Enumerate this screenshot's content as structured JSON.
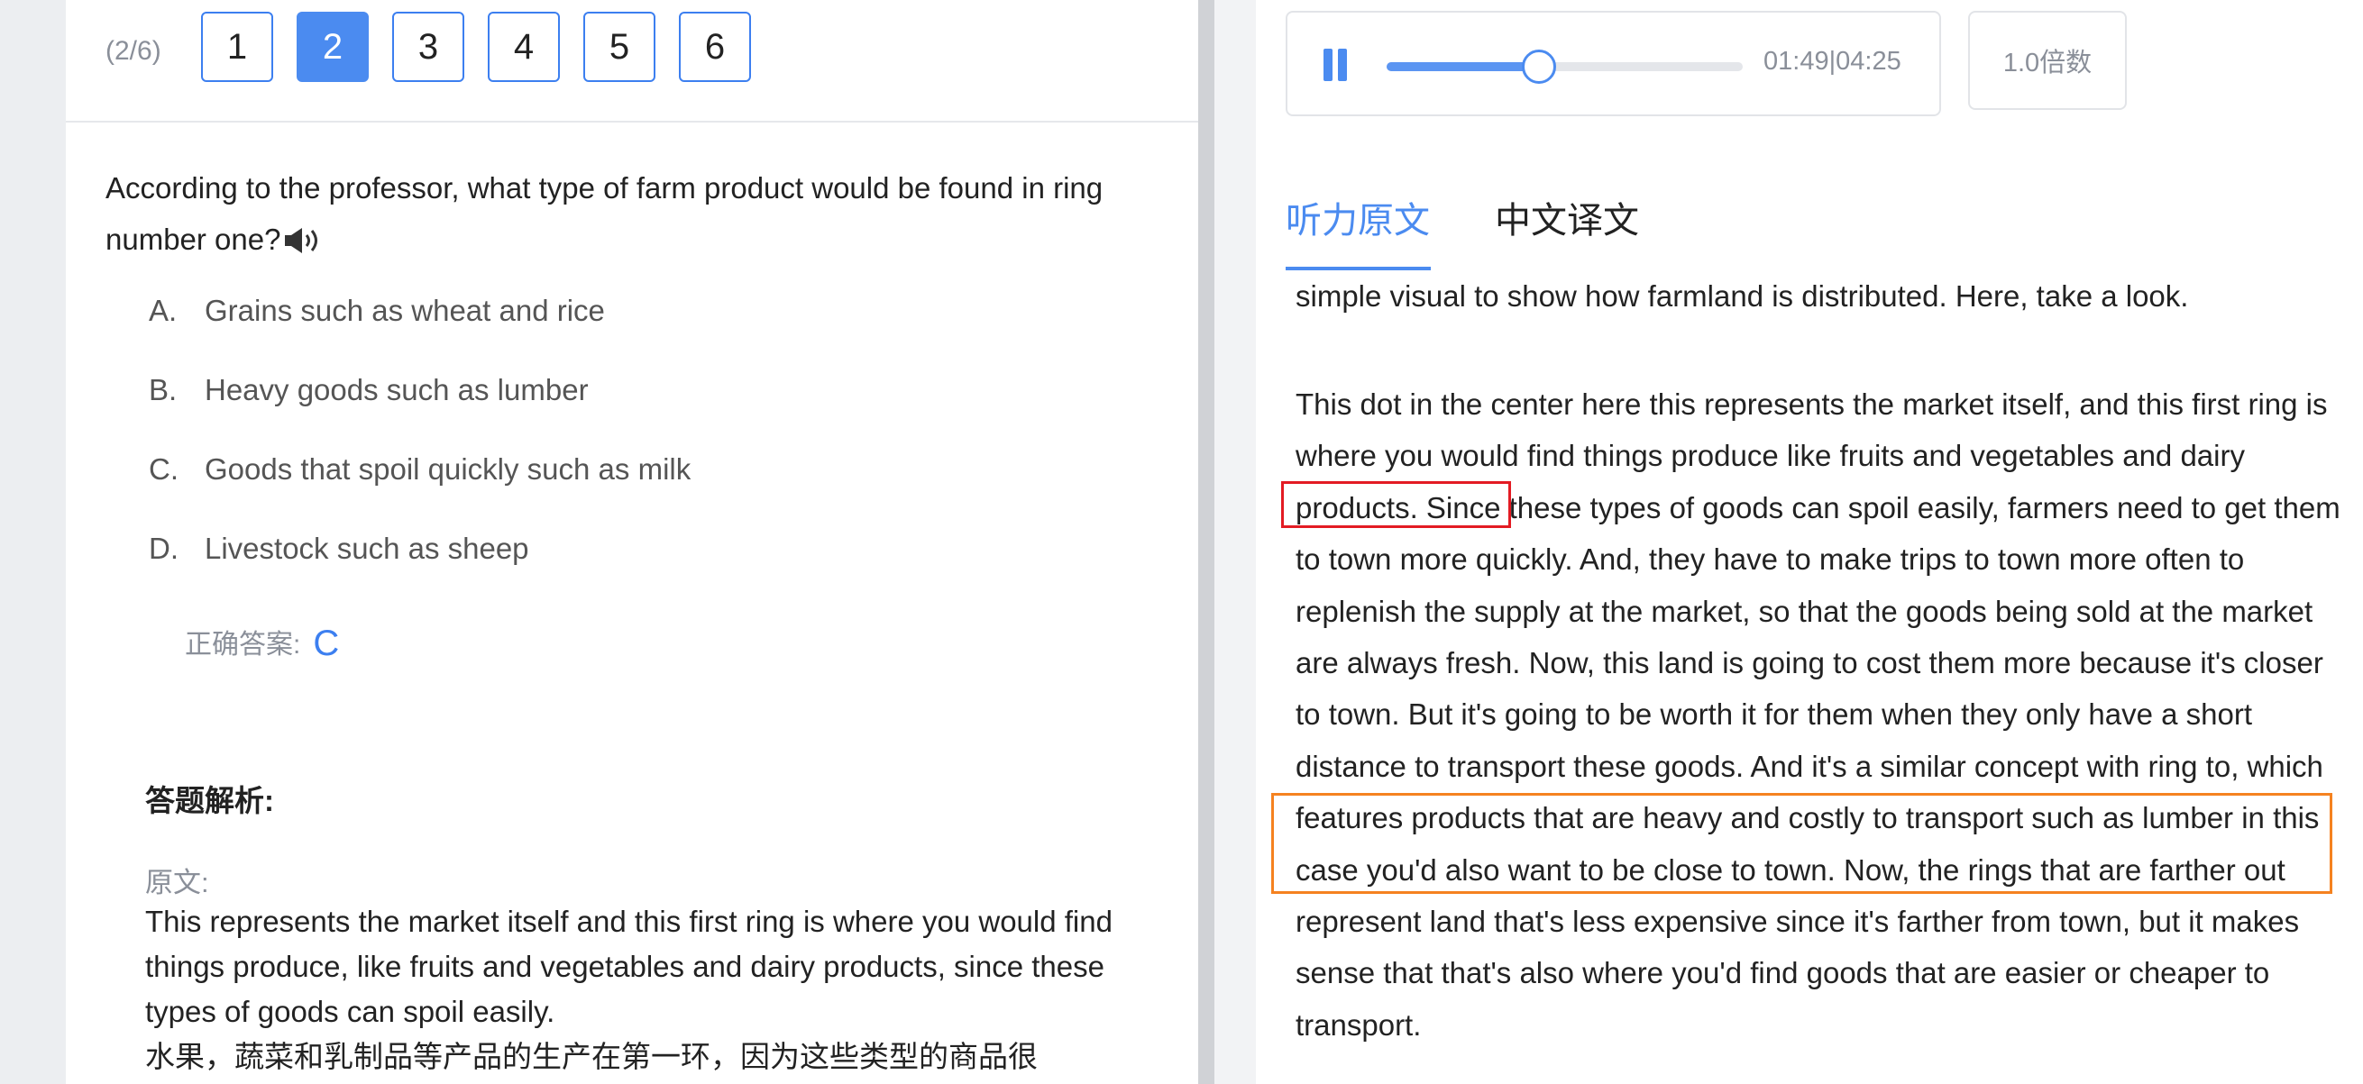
{
  "question_nav": {
    "progress": "(2/6)",
    "buttons": [
      "1",
      "2",
      "3",
      "4",
      "5",
      "6"
    ],
    "active_index": 1
  },
  "question": {
    "text": "According to the professor, what type of farm product would be found in ring number one?",
    "speaker_icon": "speaker-icon"
  },
  "options": [
    {
      "letter": "A.",
      "text": "Grains such as wheat and rice"
    },
    {
      "letter": "B.",
      "text": "Heavy goods such as lumber"
    },
    {
      "letter": "C.",
      "text": "Goods that spoil quickly such as milk"
    },
    {
      "letter": "D.",
      "text": "Livestock such as sheep"
    }
  ],
  "answer": {
    "label": "正确答案:",
    "value": "C"
  },
  "analysis": {
    "title": "答题解析:",
    "original_label": "原文:",
    "original_text": "This represents the market itself and this first ring is where you would find things produce, like fruits and vegetables and dairy products, since these types of goods can spoil easily.",
    "translation_text": "水果，蔬菜和乳制品等产品的生产在第一环，因为这些类型的商品很"
  },
  "player": {
    "current_time": "01:49",
    "total_time": "04:25",
    "progress": 0.4275,
    "speed_label": "1.0倍数",
    "accent_color": "#4b8bf0"
  },
  "tabs": [
    {
      "label": "听力原文",
      "active": true
    },
    {
      "label": "中文译文",
      "active": false
    }
  ],
  "transcript": {
    "para_0": "simple visual to show how farmland is distributed. Here, take a look.",
    "para_1_before": "This dot in the center here this represents the market itself, and this first ring is where you would find things produce like fruits and vegetables and ",
    "para_1_red": "dairy products.",
    "para_1_middle": " Since these types of goods can spoil easily, farmers need to get them to town more quickly. And, they have to make trips to town more often to replenish the supply at the market, so that the goods being sold at the market are always fresh. Now, this land is going to cost them more because it's closer to town. But it's going to be worth it for them when they only have a short distance to transport these goods. And it's a similar ",
    "para_1_orange": "concept with ring to, which features products that are heavy and costly to transport such as lumber in this case you'd also want to be close to town.",
    "para_1_after": " Now, the rings that are farther out represent land that's less expensive since it's farther from town, but it makes sense that that's also where you'd find goods that are easier or cheaper to transport.",
    "highlight_colors": {
      "red": "#e31b23",
      "orange": "#f58220"
    }
  }
}
